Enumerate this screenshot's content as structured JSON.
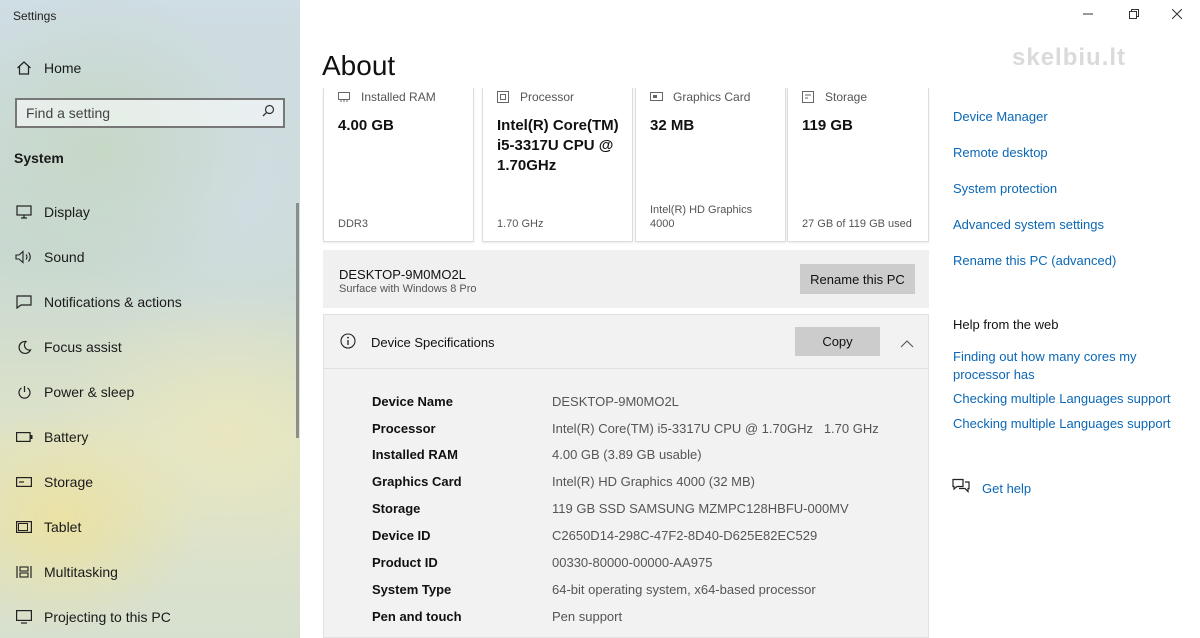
{
  "app": {
    "title": "Settings",
    "watermark": "skelbiu.lt"
  },
  "sidebar": {
    "home": {
      "label": "Home",
      "icon": "home-icon"
    },
    "search": {
      "placeholder": "Find a setting"
    },
    "section_title": "System",
    "items": [
      {
        "label": "Display",
        "icon": "display-icon"
      },
      {
        "label": "Sound",
        "icon": "sound-icon"
      },
      {
        "label": "Notifications & actions",
        "icon": "notifications-icon"
      },
      {
        "label": "Focus assist",
        "icon": "moon-icon"
      },
      {
        "label": "Power & sleep",
        "icon": "power-icon"
      },
      {
        "label": "Battery",
        "icon": "battery-icon"
      },
      {
        "label": "Storage",
        "icon": "storage-icon"
      },
      {
        "label": "Tablet",
        "icon": "tablet-icon"
      },
      {
        "label": "Multitasking",
        "icon": "multitasking-icon"
      },
      {
        "label": "Projecting to this PC",
        "icon": "projecting-icon"
      }
    ]
  },
  "main": {
    "title": "About",
    "cards": [
      {
        "label": "Installed RAM",
        "value": "4.00 GB",
        "sub": "DDR3",
        "icon": "ram-icon"
      },
      {
        "label": "Processor",
        "value": "Intel(R) Core(TM) i5-3317U CPU @ 1.70GHz",
        "sub": "1.70 GHz",
        "icon": "processor-icon"
      },
      {
        "label": "Graphics Card",
        "value": "32 MB",
        "sub": "Intel(R) HD Graphics 4000",
        "icon": "graphics-card-icon"
      },
      {
        "label": "Storage",
        "value": "119 GB",
        "sub": "27 GB of 119 GB used",
        "icon": "storage-icon"
      }
    ],
    "pc": {
      "name": "DESKTOP-9M0MO2L",
      "model": "Surface with Windows 8 Pro",
      "rename_label": "Rename this PC"
    },
    "specs": {
      "title": "Device Specifications",
      "copy_label": "Copy",
      "rows": [
        {
          "key": "Device Name",
          "value": "DESKTOP-9M0MO2L"
        },
        {
          "key": "Processor",
          "value": "Intel(R) Core(TM) i5-3317U CPU @ 1.70GHz   1.70 GHz"
        },
        {
          "key": "Installed RAM",
          "value": "4.00 GB (3.89 GB usable)"
        },
        {
          "key": "Graphics Card",
          "value": "Intel(R) HD Graphics 4000 (32 MB)"
        },
        {
          "key": "Storage",
          "value": "119 GB SSD SAMSUNG MZMPC128HBFU-000MV"
        },
        {
          "key": "Device ID",
          "value": "C2650D14-298C-47F2-8D40-D625E82EC529"
        },
        {
          "key": "Product ID",
          "value": "00330-80000-00000-AA975"
        },
        {
          "key": "System Type",
          "value": "64-bit operating system, x64-based processor"
        },
        {
          "key": "Pen and touch",
          "value": "Pen support"
        }
      ]
    }
  },
  "right": {
    "related": [
      "Device Manager",
      "Remote desktop",
      "System protection",
      "Advanced system settings",
      "Rename this PC (advanced)"
    ],
    "help_title": "Help from the web",
    "help_links": [
      "Finding out how many cores my processor has",
      "Checking multiple Languages support",
      "Checking multiple Languages support"
    ],
    "get_help": "Get help"
  },
  "colors": {
    "link": "#0b67b5",
    "button": "#cccccc",
    "panel": "#f2f2f2"
  }
}
